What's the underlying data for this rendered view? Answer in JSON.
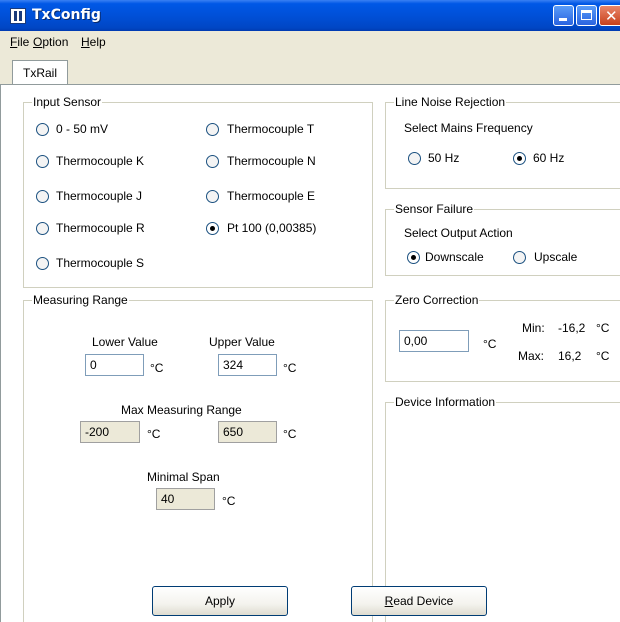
{
  "window": {
    "title": "TxConfig"
  },
  "menu": {
    "file": "File",
    "file_accel": "F",
    "option": "Option",
    "option_accel": "O",
    "help": "Help",
    "help_accel": "H"
  },
  "tabs": {
    "active": "TxRail"
  },
  "input_sensor": {
    "title": "Input Sensor",
    "options": [
      {
        "label": "0 - 50 mV",
        "selected": false
      },
      {
        "label": "Thermocouple K",
        "selected": false
      },
      {
        "label": "Thermocouple J",
        "selected": false
      },
      {
        "label": "Thermocouple R",
        "selected": false
      },
      {
        "label": "Thermocouple S",
        "selected": false
      },
      {
        "label": "Thermocouple T",
        "selected": false
      },
      {
        "label": "Thermocouple N",
        "selected": false
      },
      {
        "label": "Thermocouple E",
        "selected": false
      },
      {
        "label": "Pt 100 (0,00385)",
        "selected": true
      }
    ]
  },
  "line_noise": {
    "title": "Line Noise Rejection",
    "prompt": "Select Mains Frequency",
    "options": [
      {
        "label": "50 Hz",
        "selected": false
      },
      {
        "label": "60 Hz",
        "selected": true
      }
    ]
  },
  "sensor_failure": {
    "title": "Sensor Failure",
    "prompt": "Select Output Action",
    "options": [
      {
        "label": "Downscale",
        "selected": true
      },
      {
        "label": "Upscale",
        "selected": false
      }
    ]
  },
  "measuring_range": {
    "title": "Measuring Range",
    "lower_label": "Lower Value",
    "lower_value": "0",
    "upper_label": "Upper Value",
    "upper_value": "324",
    "max_label": "Max Measuring Range",
    "max_min": "-200",
    "max_max": "650",
    "span_label": "Minimal Span",
    "span_value": "40",
    "unit": "°C"
  },
  "zero_correction": {
    "title": "Zero Correction",
    "value": "0,00",
    "unit": "°C",
    "min_label": "Min:",
    "min_value": "-16,2",
    "max_label": "Max:",
    "max_value": "16,2"
  },
  "device_info": {
    "title": "Device Information"
  },
  "buttons": {
    "apply": "Apply",
    "read_device": "Read Device",
    "read_accel": "R",
    "read_rest": "ead Device"
  }
}
